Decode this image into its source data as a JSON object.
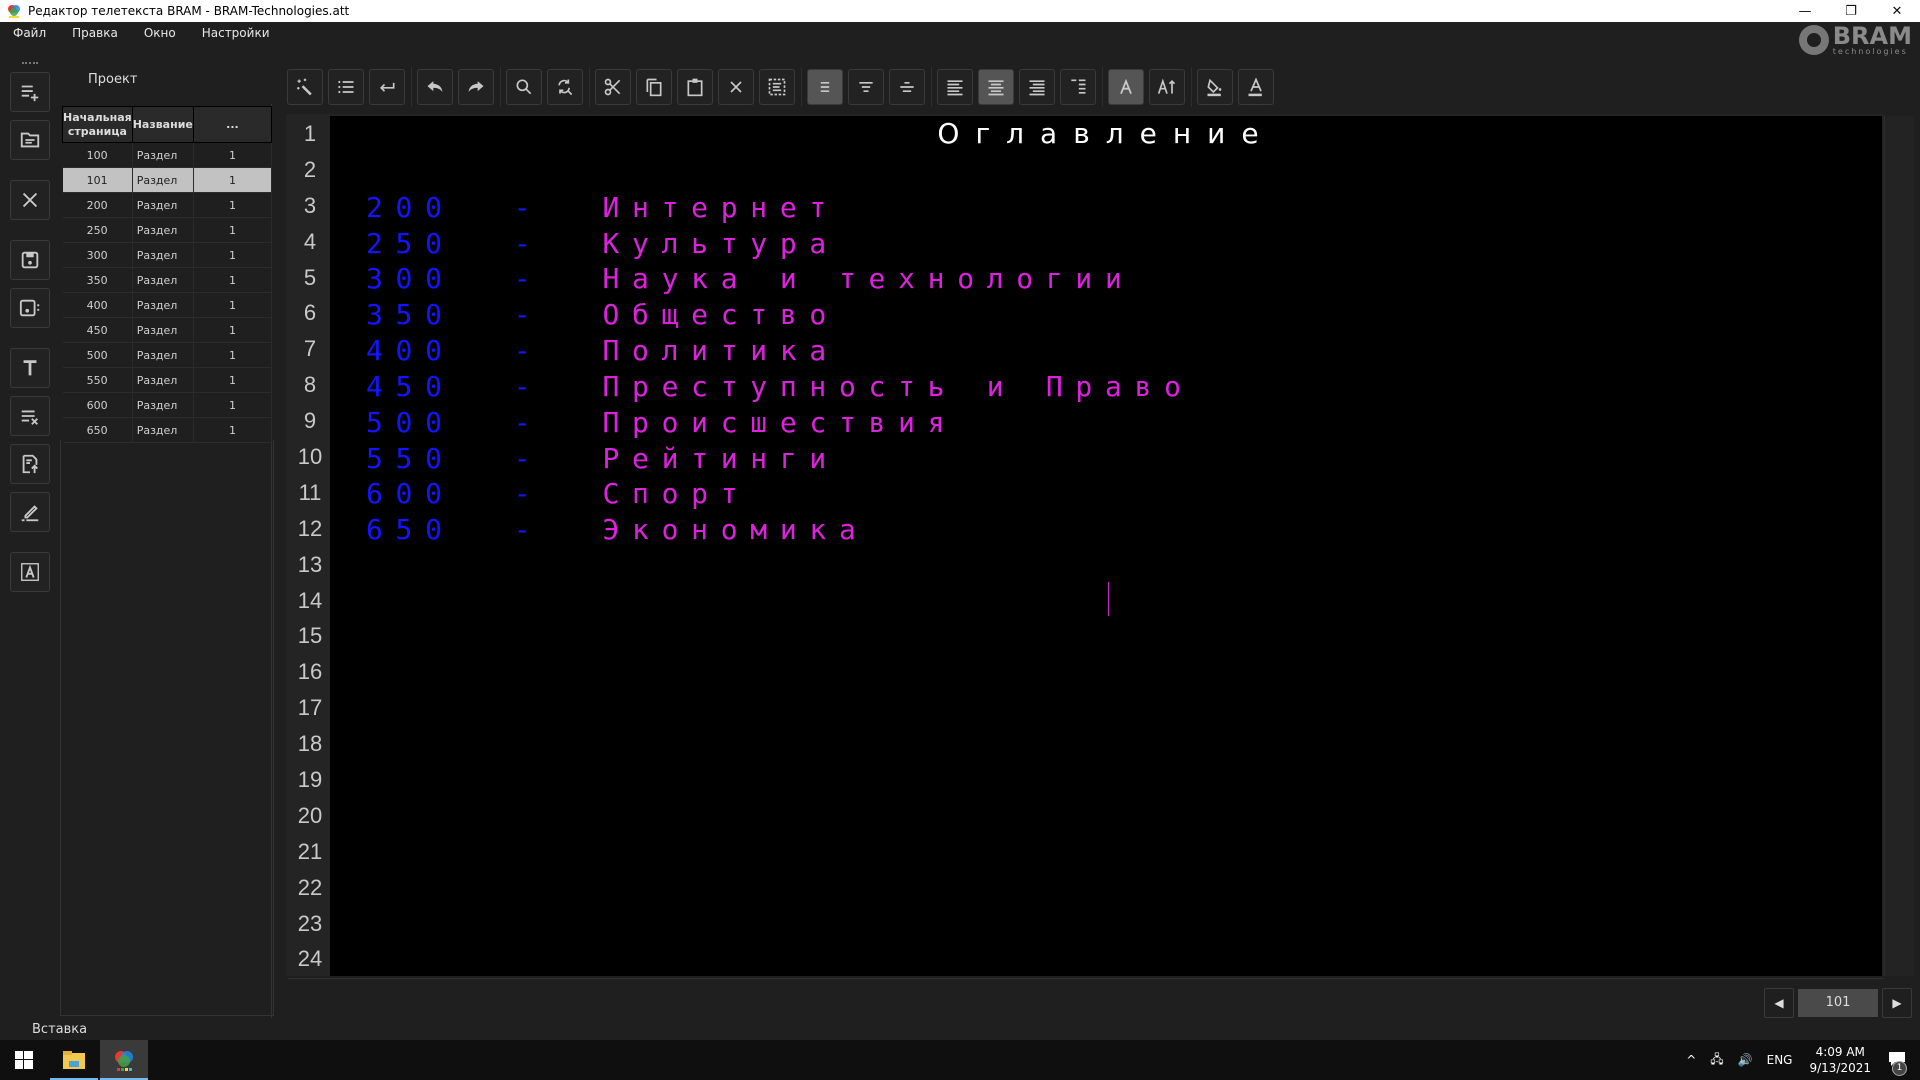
{
  "window": {
    "title": "Редактор телетекста BRAM - BRAM-Technologies.att",
    "controls": {
      "minimize": "—",
      "restore": "❐",
      "close": "✕"
    }
  },
  "menu": [
    "Файл",
    "Правка",
    "Окно",
    "Настройки"
  ],
  "logo": {
    "name": "BRAM",
    "sub": "technologies"
  },
  "sidebar": {
    "buttons": [
      "add-page-icon",
      "open-folder-icon",
      "close-icon",
      "save-icon",
      "save-as-icon",
      "text-icon",
      "clear-format-icon",
      "export-icon",
      "edit-pencil-icon",
      "font-box-icon"
    ]
  },
  "project": {
    "title": "Проект",
    "columns": [
      "Начальная страница",
      "Название",
      "..."
    ],
    "rows": [
      {
        "page": "100",
        "name": "Раздел",
        "count": "1"
      },
      {
        "page": "101",
        "name": "Раздел",
        "count": "1",
        "selected": true
      },
      {
        "page": "200",
        "name": "Раздел",
        "count": "1"
      },
      {
        "page": "250",
        "name": "Раздел",
        "count": "1"
      },
      {
        "page": "300",
        "name": "Раздел",
        "count": "1"
      },
      {
        "page": "350",
        "name": "Раздел",
        "count": "1"
      },
      {
        "page": "400",
        "name": "Раздел",
        "count": "1"
      },
      {
        "page": "450",
        "name": "Раздел",
        "count": "1"
      },
      {
        "page": "500",
        "name": "Раздел",
        "count": "1"
      },
      {
        "page": "550",
        "name": "Раздел",
        "count": "1"
      },
      {
        "page": "600",
        "name": "Раздел",
        "count": "1"
      },
      {
        "page": "650",
        "name": "Раздел",
        "count": "1"
      }
    ]
  },
  "toolbar": {
    "groups": [
      [
        "magic-wand-icon",
        "list-icon",
        "enter-icon"
      ],
      [
        "undo-icon",
        "redo-icon"
      ],
      [
        "search-icon",
        "replace-icon"
      ],
      [
        "cut-icon",
        "copy-icon",
        "paste-icon",
        "delete-icon",
        "select-all-icon"
      ],
      [
        "valign-middle-icon",
        "valign-top-icon",
        "valign-bottom-icon"
      ],
      [
        "align-left-icon",
        "align-center-icon",
        "align-right-icon",
        "align-justify-icon"
      ],
      [
        "font-icon",
        "font-size-icon"
      ],
      [
        "fill-color-icon",
        "text-color-icon"
      ]
    ],
    "active": [
      "valign-middle-icon",
      "align-center-icon",
      "font-icon"
    ]
  },
  "editor": {
    "line_numbers": [
      "1",
      "2",
      "3",
      "4",
      "5",
      "6",
      "7",
      "8",
      "9",
      "10",
      "11",
      "12",
      "13",
      "14",
      "15",
      "16",
      "17",
      "18",
      "19",
      "20",
      "21",
      "22",
      "23",
      "24"
    ],
    "title_line": "Оглавление",
    "entries": [
      {
        "line": 3,
        "page": "200",
        "dash": "-",
        "text": "Интернет"
      },
      {
        "line": 4,
        "page": "250",
        "dash": "-",
        "text": "Культура"
      },
      {
        "line": 5,
        "page": "300",
        "dash": "-",
        "text": "Наука и технологии"
      },
      {
        "line": 6,
        "page": "350",
        "dash": "-",
        "text": "Общество"
      },
      {
        "line": 7,
        "page": "400",
        "dash": "-",
        "text": "Политика"
      },
      {
        "line": 8,
        "page": "450",
        "dash": "-",
        "text": "Преступность и Право"
      },
      {
        "line": 9,
        "page": "500",
        "dash": "-",
        "text": "Происшествия"
      },
      {
        "line": 10,
        "page": "550",
        "dash": "-",
        "text": "Рейтинги"
      },
      {
        "line": 11,
        "page": "600",
        "dash": "-",
        "text": "Спорт"
      },
      {
        "line": 12,
        "page": "650",
        "dash": "-",
        "text": "Экономика"
      }
    ],
    "colors": {
      "title": "#ffffff",
      "page": "#1414ff",
      "text": "#dd22dd",
      "background": "#000000"
    }
  },
  "pager": {
    "prev": "◀",
    "current_page": "101",
    "next": "▶"
  },
  "status": "Вставка",
  "taskbar": {
    "items": [
      "start-icon",
      "file-explorer-icon",
      "bram-app-icon"
    ],
    "tray": {
      "chevron": "^",
      "lang": "ENG",
      "time": "4:09 AM",
      "date": "9/13/2021",
      "notifications": "1"
    }
  }
}
